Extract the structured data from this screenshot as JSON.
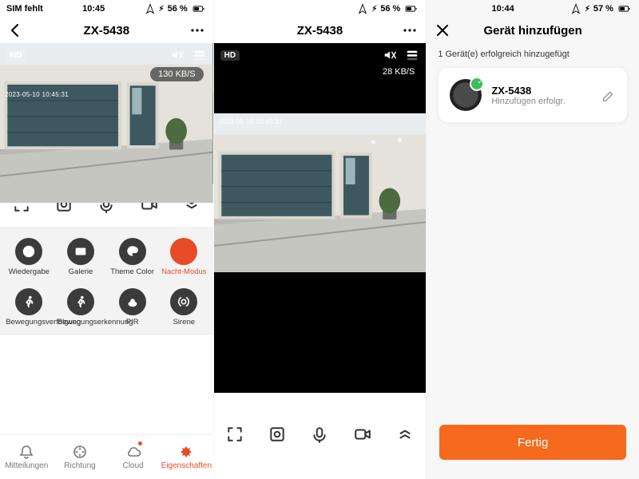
{
  "status": {
    "carrier": "SIM fehlt",
    "time": "10:45",
    "battery1": "56 %",
    "time3": "10:44",
    "battery3": "57 %"
  },
  "phone1": {
    "title": "ZX-5438",
    "hd": "HD",
    "kbps": "130 KB/S",
    "osd_ts": "2023-05-10 10:45:31",
    "toolbar_icons": {
      "fullscreen": "fullscreen-icon",
      "snapshot": "snapshot-icon",
      "mic": "mic-icon",
      "record": "record-icon",
      "collapse": "collapse-icon"
    },
    "features": {
      "playback": "Wiedergabe",
      "gallery": "Galerie",
      "theme": "Theme Color",
      "night": "Nacht-Modus",
      "track": "Bewegungsverfolgung",
      "detect": "Bewegungserkennung",
      "pir": "PIR",
      "siren": "Sirene"
    },
    "tabs": {
      "notify": "Mitteilungen",
      "dir": "Richtung",
      "cloud": "Cloud",
      "props": "Eigenschaften"
    }
  },
  "phone2": {
    "title": "ZX-5438",
    "hd": "HD",
    "kbps": "28 KB/S",
    "osd_ts": "2023-05-10 10:45:31"
  },
  "phone3": {
    "title": "Gerät hinzufügen",
    "success": "1 Gerät(e) erfolgreich hinzugefügt",
    "device_name": "ZX-5438",
    "device_sub": "Hinzufügen erfolgr.",
    "done": "Fertig"
  }
}
